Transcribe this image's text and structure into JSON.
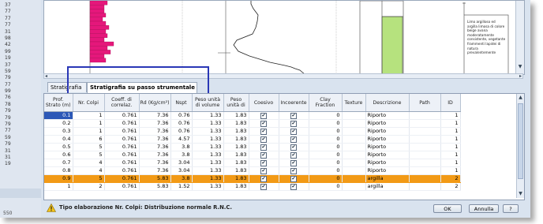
{
  "gutter_numbers": [
    "37",
    "77",
    "77",
    "77",
    "31",
    "98",
    "42",
    "99",
    "19",
    "37",
    "59",
    "79",
    "77",
    "99",
    "76",
    "78",
    "79",
    "79",
    "79",
    "77",
    "59",
    "79",
    "31",
    "31",
    "19"
  ],
  "gutter_bottom": "550",
  "preview": {
    "description_lines": [
      "Limo argilloso ed",
      "argilla limosa di colore",
      "beige avana",
      "moderatamente",
      "consistente, vegetante",
      "frammenti lapidei di",
      "natura",
      "prevalentemente"
    ]
  },
  "tabs": [
    {
      "label": "Stratigrafia"
    },
    {
      "label": "Stratigrafia su passo strumentale"
    }
  ],
  "table": {
    "headers": [
      "Prof. Strato (m)",
      "Nr. Colpi",
      "Coeff. di correlaz.",
      "Rd (Kg/cm²)",
      "Nspt",
      "Peso unità di volume",
      "Peso unità di",
      "Coesivo",
      "Incoerente",
      "Clay Fraction",
      "Texture",
      "Descrizione",
      "Path",
      "ID"
    ],
    "rows": [
      {
        "prof": "0.1",
        "colpi": "1",
        "coeff": "0.761",
        "rd": "7.36",
        "nspt": "0.76",
        "peso_vol": "1.33",
        "peso": "1.83",
        "coesivo": true,
        "incoerente": true,
        "clay": "0",
        "texture": "",
        "descr": "Riporto",
        "path": "",
        "id": "1"
      },
      {
        "prof": "0.2",
        "colpi": "1",
        "coeff": "0.761",
        "rd": "7.36",
        "nspt": "0.76",
        "peso_vol": "1.33",
        "peso": "1.83",
        "coesivo": true,
        "incoerente": true,
        "clay": "0",
        "texture": "",
        "descr": "Riporto",
        "path": "",
        "id": "1"
      },
      {
        "prof": "0.3",
        "colpi": "1",
        "coeff": "0.761",
        "rd": "7.36",
        "nspt": "0.76",
        "peso_vol": "1.33",
        "peso": "1.83",
        "coesivo": true,
        "incoerente": true,
        "clay": "0",
        "texture": "",
        "descr": "Riporto",
        "path": "",
        "id": "1"
      },
      {
        "prof": "0.4",
        "colpi": "6",
        "coeff": "0.761",
        "rd": "7.36",
        "nspt": "4.57",
        "peso_vol": "1.33",
        "peso": "1.83",
        "coesivo": true,
        "incoerente": true,
        "clay": "0",
        "texture": "",
        "descr": "Riporto",
        "path": "",
        "id": "1"
      },
      {
        "prof": "0.5",
        "colpi": "5",
        "coeff": "0.761",
        "rd": "7.36",
        "nspt": "3.8",
        "peso_vol": "1.33",
        "peso": "1.83",
        "coesivo": true,
        "incoerente": true,
        "clay": "0",
        "texture": "",
        "descr": "Riporto",
        "path": "",
        "id": "1"
      },
      {
        "prof": "0.6",
        "colpi": "5",
        "coeff": "0.761",
        "rd": "7.36",
        "nspt": "3.8",
        "peso_vol": "1.33",
        "peso": "1.83",
        "coesivo": true,
        "incoerente": true,
        "clay": "0",
        "texture": "",
        "descr": "Riporto",
        "path": "",
        "id": "1"
      },
      {
        "prof": "0.7",
        "colpi": "4",
        "coeff": "0.761",
        "rd": "7.36",
        "nspt": "3.04",
        "peso_vol": "1.33",
        "peso": "1.83",
        "coesivo": true,
        "incoerente": true,
        "clay": "0",
        "texture": "",
        "descr": "Riporto",
        "path": "",
        "id": "1"
      },
      {
        "prof": "0.8",
        "colpi": "4",
        "coeff": "0.761",
        "rd": "7.36",
        "nspt": "3.04",
        "peso_vol": "1.33",
        "peso": "1.83",
        "coesivo": true,
        "incoerente": true,
        "clay": "0",
        "texture": "",
        "descr": "Riporto",
        "path": "",
        "id": "1"
      },
      {
        "prof": "0.9",
        "colpi": "5",
        "coeff": "0.761",
        "rd": "5.83",
        "nspt": "3.8",
        "peso_vol": "1.33",
        "peso": "1.83",
        "coesivo": true,
        "incoerente": true,
        "clay": "0",
        "texture": "",
        "descr": "argilla",
        "path": "",
        "id": "2",
        "selected": true
      },
      {
        "prof": "1",
        "colpi": "2",
        "coeff": "0.761",
        "rd": "5.83",
        "nspt": "1.52",
        "peso_vol": "1.33",
        "peso": "1.83",
        "coesivo": true,
        "incoerente": true,
        "clay": "0",
        "texture": "",
        "descr": "argilla",
        "path": "",
        "id": "2"
      }
    ]
  },
  "status": {
    "message": "Tipo elaborazione Nr. Colpi: Distribuzione normale R.N.C.",
    "ok_label": "OK",
    "cancel_label": "Annulla",
    "help_label": "?"
  },
  "colors": {
    "selected_row": "#f29a16",
    "current_cell": "#2c58b7",
    "histogram": "#e5177b",
    "highlight_box": "#2a37b6",
    "layer_fill": "#b6e27e"
  }
}
